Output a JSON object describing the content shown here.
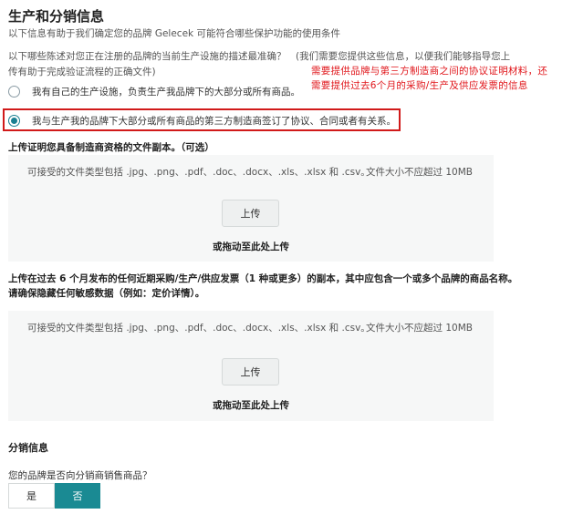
{
  "header": {
    "title": "生产和分销信息",
    "subtitle": "以下信息有助于我们确定您的品牌 Gelecek 可能符合哪些保护功能的使用条件"
  },
  "production": {
    "question": "以下哪些陈述对您正在注册的品牌的当前生产设施的描述最准确？　(我们需要您提供这些信息，以便我们能够指导您上传有助于完成验证流程的正确文件)",
    "options": [
      {
        "label": "我有自己的生产设施，负责生产我品牌下的大部分或所有商品。",
        "selected": false
      },
      {
        "label": "我与生产我的品牌下大部分或所有商品的第三方制造商签订了协议、合同或者有关系。",
        "selected": true
      }
    ]
  },
  "annotation": {
    "text": "需要提供品牌与第三方制造商之间的协议证明材料，还需要提供过去6个月的采购/生产及供应发票的信息",
    "color": "#e0151a"
  },
  "uploads": [
    {
      "heading": "上传证明您具备制造商资格的文件副本。（可选）",
      "accepted_types": "可接受的文件类型包括 .jpg、.png、.pdf、.doc、.docx、.xls、.xlsx 和 .csv。",
      "size_limit": "文件大小不应超过 10MB",
      "button_label": "上传",
      "drag_text": "或拖动至此处上传"
    },
    {
      "heading": "上传在过去 6 个月发布的任何近期采购/生产/供应发票（1 种或更多）的副本，其中应包含一个或多个品牌的商品名称。请确保隐藏任何敏感数据（例如：定价详情）。",
      "accepted_types": "可接受的文件类型包括 .jpg、.png、.pdf、.doc、.docx、.xls、.xlsx 和 .csv。",
      "size_limit": "文件大小不应超过 10MB",
      "button_label": "上传",
      "drag_text": "或拖动至此处上传"
    }
  ],
  "distribution": {
    "heading": "分销信息",
    "question": "您的品牌是否向分销商销售商品？",
    "yes_label": "是",
    "no_label": "否",
    "selected": "否"
  },
  "colors": {
    "accent": "#1a8a93",
    "highlight_border": "#d11a1a"
  }
}
